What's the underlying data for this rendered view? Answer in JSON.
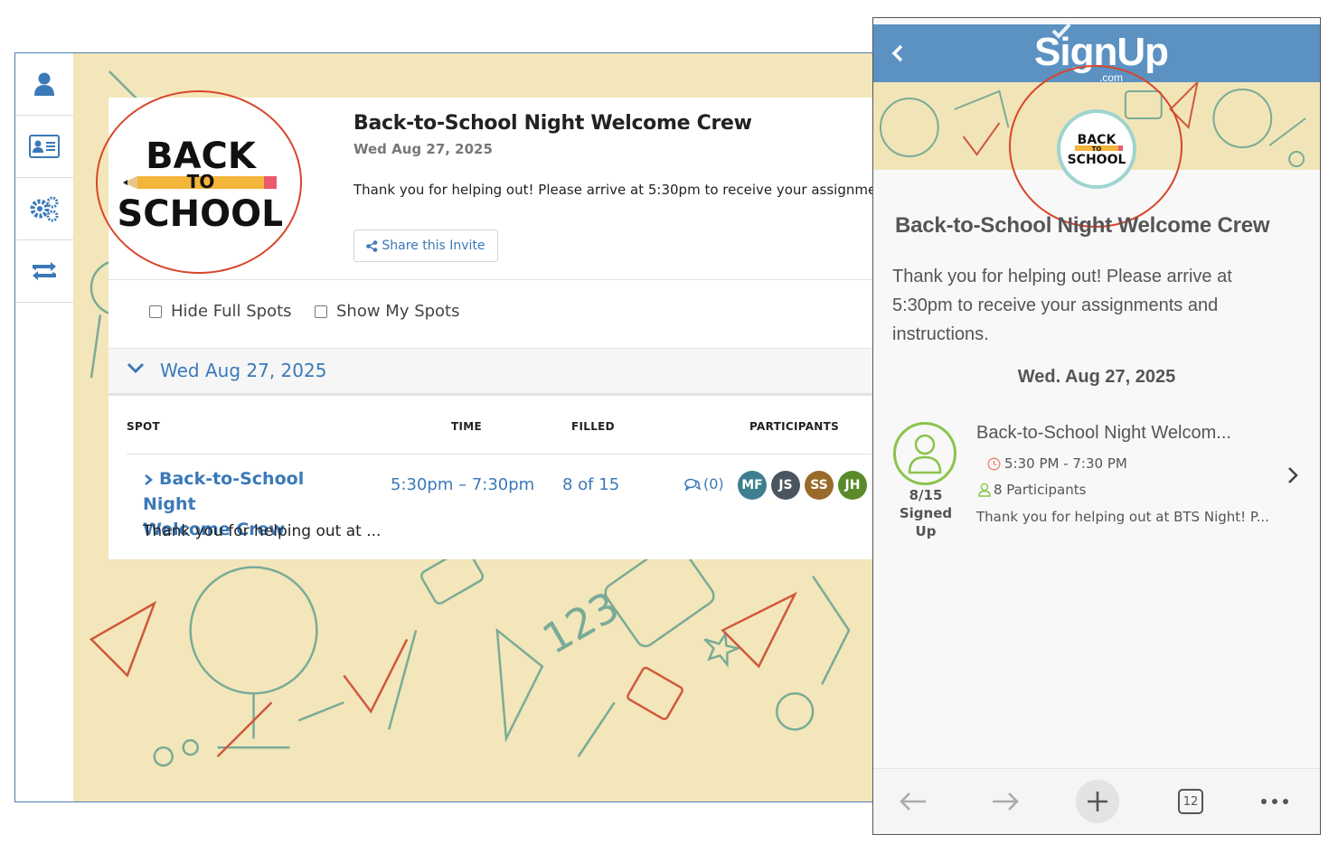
{
  "desktop": {
    "event": {
      "title": "Back-to-School Night Welcome Crew",
      "date": "Wed Aug 27, 2025",
      "description": "Thank you for helping out! Please arrive at 5:30pm to receive your assignme",
      "share_label": "Share this Invite",
      "logo": {
        "line1": "BACK",
        "line2": "TO",
        "line3": "SCHOOL"
      }
    },
    "filters": {
      "hide_full": "Hide Full Spots",
      "show_mine": "Show My Spots"
    },
    "date_group": "Wed Aug 27, 2025",
    "table": {
      "headers": {
        "spot": "SPOT",
        "time": "TIME",
        "filled": "FILLED",
        "participants": "PARTICIPANTS"
      },
      "row": {
        "spot_line1": "Back-to-School Night",
        "spot_line2": "Welcome Crew",
        "spot_desc": "Thank you for helping out at ...",
        "time": "5:30pm – 7:30pm",
        "filled": "8 of 15",
        "comments": "(0)",
        "avatars": [
          {
            "initials": "MF",
            "color": "#3d7f8f"
          },
          {
            "initials": "JS",
            "color": "#4a5560"
          },
          {
            "initials": "SS",
            "color": "#9a6a2a"
          },
          {
            "initials": "JH",
            "color": "#5a8a2a"
          }
        ]
      }
    },
    "sidebar": [
      "user-icon",
      "contact-card-icon",
      "settings-gears-icon",
      "retweet-icon"
    ]
  },
  "phone": {
    "brand": "SignUp",
    "brand_suffix": ".com",
    "logo": {
      "line1": "BACK",
      "line2": "TO",
      "line3": "SCHOOL"
    },
    "title": "Back-to-School Night Welcome Crew",
    "description": "Thank you for helping out! Please arrive at 5:30pm to receive your assignments and instructions.",
    "date": "Wed. Aug 27, 2025",
    "slot": {
      "count": "8/15",
      "count_label": "Signed Up",
      "name": "Back-to-School Night Welcom...",
      "time": "5:30 PM - 7:30 PM",
      "participants": "8 Participants",
      "desc": "Thank you for helping out at BTS Night! P..."
    },
    "toolbar": {
      "tabs_count": "12"
    }
  },
  "colors": {
    "accent": "#3b79b8",
    "header": "#5b92c2",
    "highlight": "#d9452b",
    "green": "#8bc34a"
  }
}
